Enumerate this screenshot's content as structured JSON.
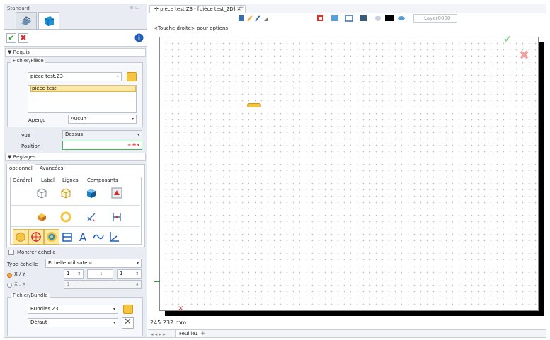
{
  "panel": {
    "title": "Standard",
    "pins": "≡ ☐"
  },
  "sections": {
    "requis": "▼ Requis",
    "reglages": "▼ Réglages"
  },
  "file_group": {
    "legend": "Fichier/Pièce",
    "file_value": "pièce test.Z3",
    "list_items": [
      "pièce test"
    ],
    "preview_label": "Aperçu",
    "preview_value": "Aucun"
  },
  "view": {
    "label": "Vue",
    "value": "Dessus"
  },
  "position": {
    "label": "Position",
    "value": "",
    "suffix": "≈ ✤ ▾"
  },
  "settings_tabs": [
    "optionnel",
    "Avancées"
  ],
  "sub_tabs": [
    "Général",
    "Label",
    "Lignes",
    "Composants"
  ],
  "show_scale": "Montrer échelle",
  "scale_type": {
    "label": "Type échelle",
    "value": "Echelle utilisateur"
  },
  "ratio": {
    "xy_label": "X / Y",
    "xx_label": "X . X",
    "a": "1",
    "b": ":",
    "c": "1",
    "d": "1"
  },
  "bundle_group": {
    "legend": "Fichier/Bundle",
    "bundle_value": "Bundles.Z3",
    "default_value": "Défaut"
  },
  "doc_tab": {
    "label": "✢ pièce test.Z3 - [pièce test_2D] ✕",
    "add": "+"
  },
  "layer": "Layer0000",
  "hint": "<Touche droite> pour options",
  "coord": "245.232 mm",
  "sheet_tab": "Feuille1",
  "sheet_nav": "◂ ◂ ▸ ▸",
  "sheet_add": "+",
  "colors": {
    "accent": "#1f8fd6",
    "selection": "#f6c540",
    "ok": "#2aa43a",
    "cancel": "#d9302c"
  }
}
